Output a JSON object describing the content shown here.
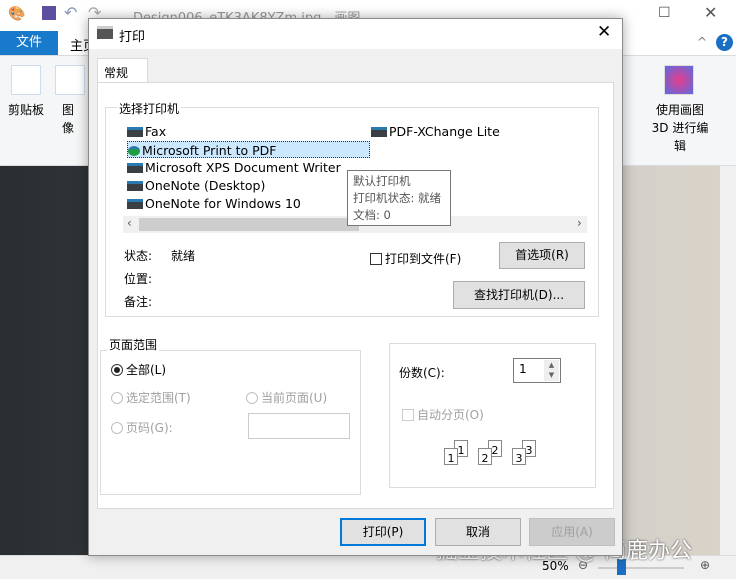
{
  "paint": {
    "title": "Design006_eTK3AK8YZm.jpg - 画图",
    "file_tab": "文件",
    "home_tab": "主页",
    "clipboard": "剪贴板",
    "image": "图像",
    "paint3d": "使用画图 3D 进行编辑",
    "zoom": "50%",
    "watermark": "掘金技术社区 @ 简鹿办公"
  },
  "dialog": {
    "title": "打印",
    "tab": "常规",
    "select_printer": "选择打印机",
    "printers": [
      {
        "name": "Fax"
      },
      {
        "name": "Microsoft Print to PDF",
        "selected": true,
        "default": true
      },
      {
        "name": "Microsoft XPS Document Writer"
      },
      {
        "name": "OneNote (Desktop)"
      },
      {
        "name": "OneNote for Windows 10"
      },
      {
        "name": "PDF-XChange Lite"
      }
    ],
    "tooltip": [
      "默认打印机",
      "打印机状态: 就绪",
      "文档: 0"
    ],
    "status_label": "状态:",
    "status_value": "就绪",
    "location_label": "位置:",
    "comment_label": "备注:",
    "print_to_file": "打印到文件(F)",
    "preferences": "首选项(R)",
    "find_printer": "查找打印机(D)...",
    "page_range": "页面范围",
    "all": "全部(L)",
    "selection": "选定范围(T)",
    "current_page": "当前页面(U)",
    "pages": "页码(G):",
    "copies_label": "份数(C):",
    "copies": "1",
    "collate": "自动分页(O)",
    "collate_pages": [
      "1",
      "1",
      "2",
      "2",
      "3",
      "3"
    ],
    "print": "打印(P)",
    "cancel": "取消",
    "apply": "应用(A)"
  }
}
